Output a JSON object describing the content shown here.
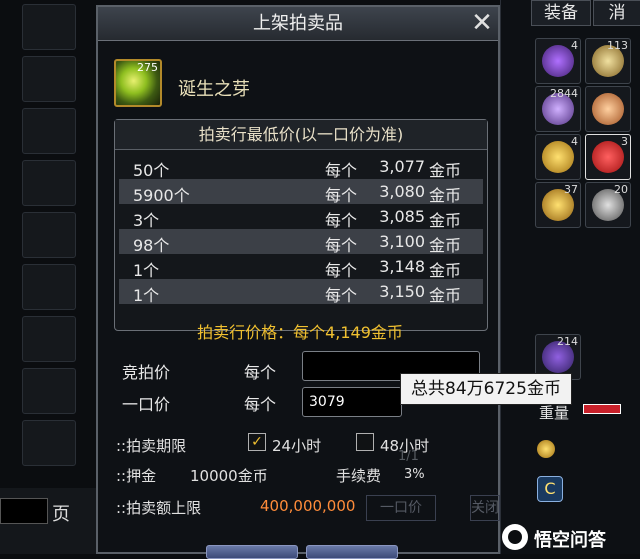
{
  "dialog": {
    "title": "上架拍卖品",
    "item": {
      "name": "诞生之芽",
      "stack_count": "275"
    },
    "price_table": {
      "header": "拍卖行最低价(以一口价为准)",
      "rows": [
        {
          "qty": "50个",
          "each": "每个",
          "amount": "3,077",
          "unit": "金币"
        },
        {
          "qty": "5900个",
          "each": "每个",
          "amount": "3,080",
          "unit": "金币"
        },
        {
          "qty": "3个",
          "each": "每个",
          "amount": "3,085",
          "unit": "金币"
        },
        {
          "qty": "98个",
          "each": "每个",
          "amount": "3,100",
          "unit": "金币"
        },
        {
          "qty": "1个",
          "each": "每个",
          "amount": "3,148",
          "unit": "金币"
        },
        {
          "qty": "1个",
          "each": "每个",
          "amount": "3,150",
          "unit": "金币"
        }
      ]
    },
    "market_price": "拍卖行价格：每个4,149金币",
    "bid": {
      "label": "竞拍价",
      "each": "每个",
      "value": ""
    },
    "buyout": {
      "label": "一口价",
      "each": "每个",
      "value": "3079"
    },
    "tooltip": "总共84万6725金币",
    "duration": {
      "label": "::拍卖期限",
      "opt24": "24小时",
      "opt48": "48小时",
      "checked": "✓"
    },
    "deposit": {
      "label": "::押金",
      "value": "10000金币",
      "fee_label": "手续费",
      "fee_value": "3%"
    },
    "limit": {
      "label": "::拍卖额上限",
      "value": "400,000,000"
    },
    "behind_text": {
      "one_price": "一口价",
      "page_frac": "1/1",
      "close_frag": "关闭"
    }
  },
  "right_panel": {
    "tabs": [
      "装备",
      "消"
    ],
    "slot_counts": [
      "4",
      "113",
      "2844",
      "",
      "4",
      "3",
      "37",
      "20",
      "214",
      ""
    ],
    "weight_label": "重量"
  },
  "left_panel": {
    "page_label": "页"
  },
  "watermark": "悟空问答",
  "colors": {
    "gold": "#f0c030",
    "orange": "#ff8c3a",
    "weight_bar": "#c8202a"
  }
}
